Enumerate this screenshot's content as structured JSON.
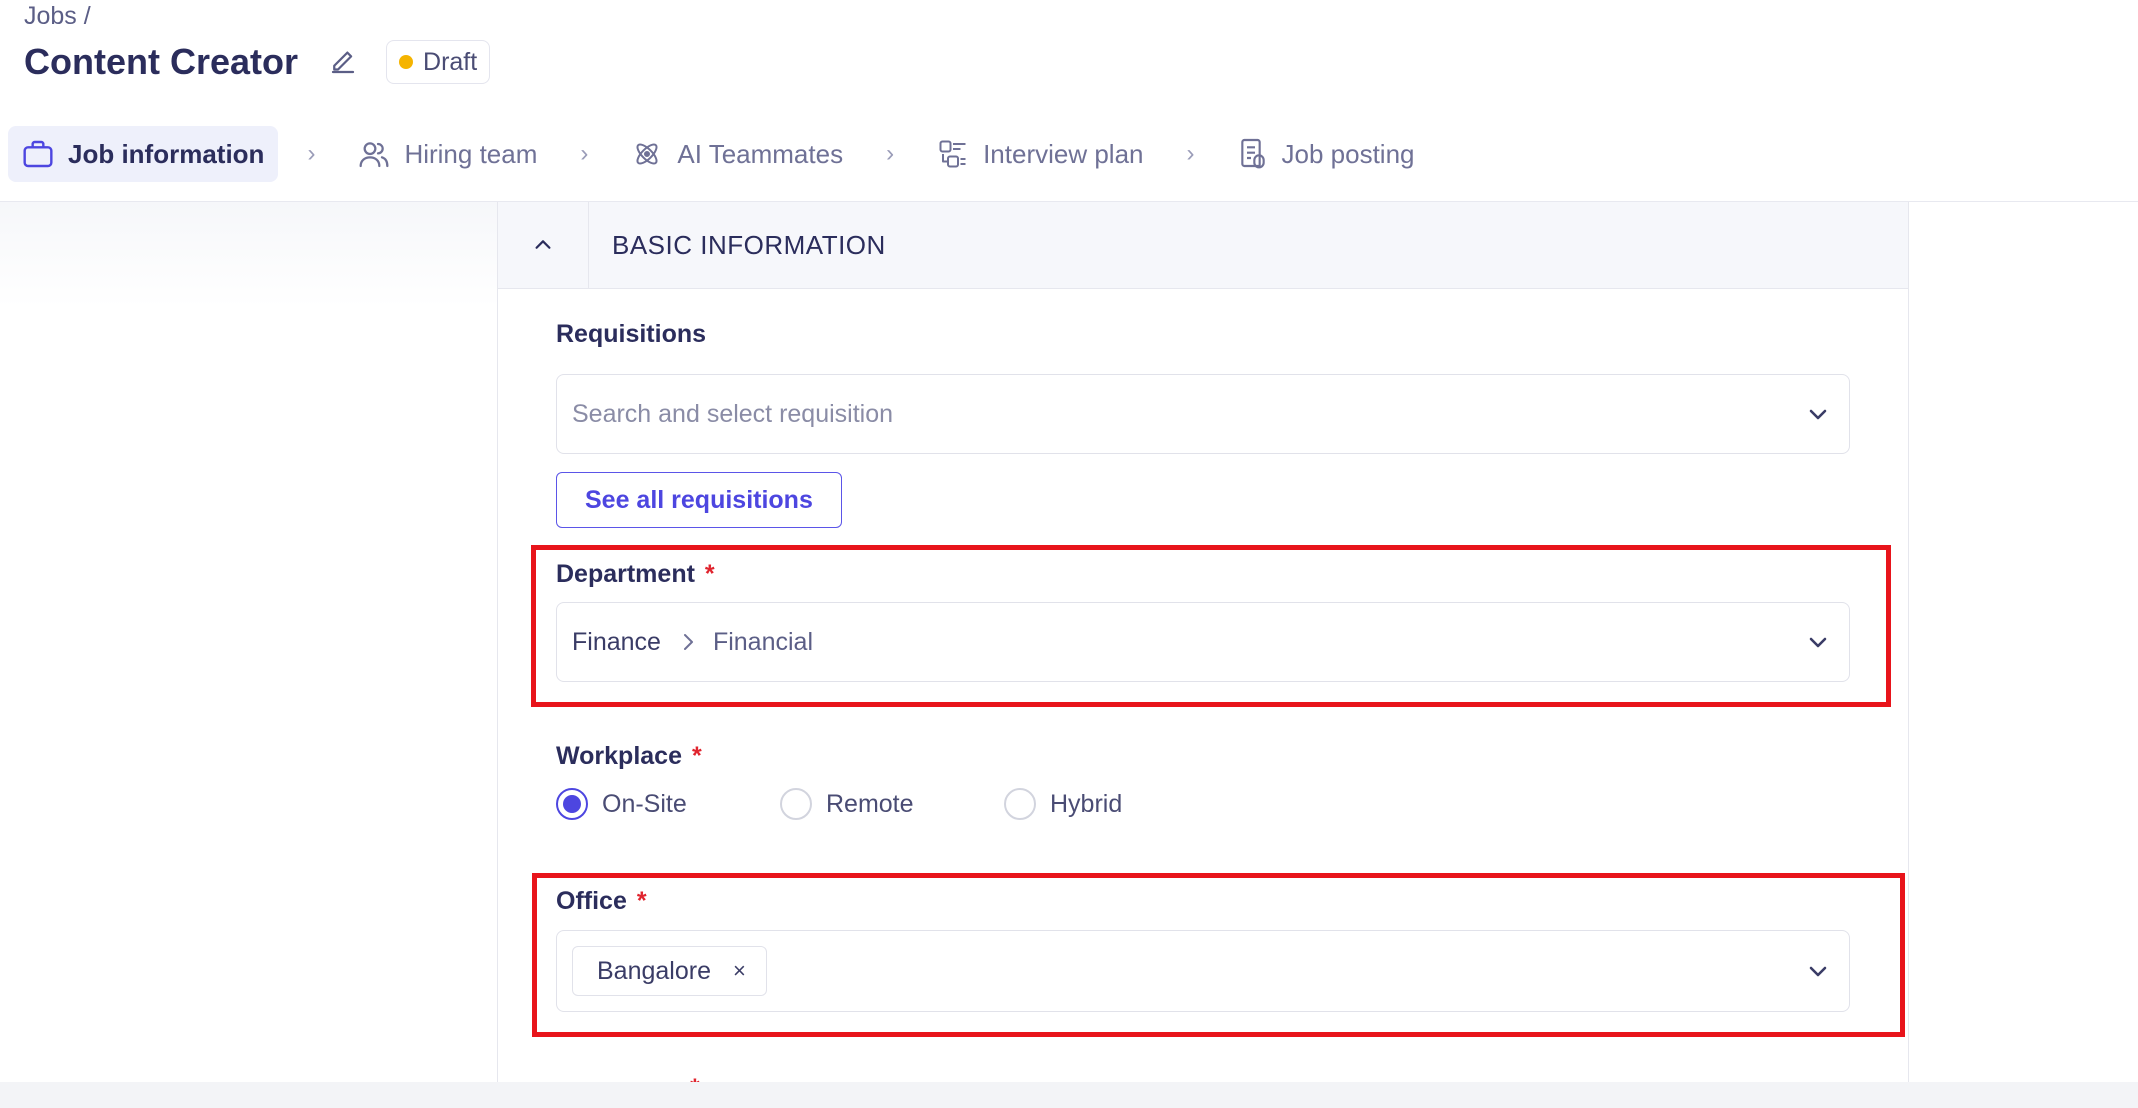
{
  "header": {
    "breadcrumb": "Jobs /",
    "title": "Content Creator",
    "status": "Draft",
    "status_color": "#f5b400"
  },
  "steps": [
    {
      "label": "Job information",
      "icon": "briefcase-icon",
      "active": true
    },
    {
      "label": "Hiring team",
      "icon": "users-icon",
      "active": false
    },
    {
      "label": "AI Teammates",
      "icon": "atom-icon",
      "active": false
    },
    {
      "label": "Interview plan",
      "icon": "plan-icon",
      "active": false
    },
    {
      "label": "Job posting",
      "icon": "document-icon",
      "active": false
    }
  ],
  "step_separator": "›",
  "section": {
    "title": "BASIC INFORMATION"
  },
  "requisitions": {
    "label": "Requisitions",
    "placeholder": "Search and select requisition",
    "see_all_label": "See all requisitions"
  },
  "department": {
    "label": "Department",
    "required": "*",
    "value_parent": "Finance",
    "value_child": "Financial"
  },
  "workplace": {
    "label": "Workplace",
    "required": "*",
    "options": [
      "On-Site",
      "Remote",
      "Hybrid"
    ],
    "selected": "On-Site"
  },
  "office": {
    "label": "Office",
    "required": "*",
    "chips": [
      "Bangalore"
    ],
    "remove_symbol": "×"
  },
  "next_field_required": "*",
  "colors": {
    "accent": "#4d46e0",
    "highlight": "#e8141b",
    "required": "#e0242e"
  }
}
